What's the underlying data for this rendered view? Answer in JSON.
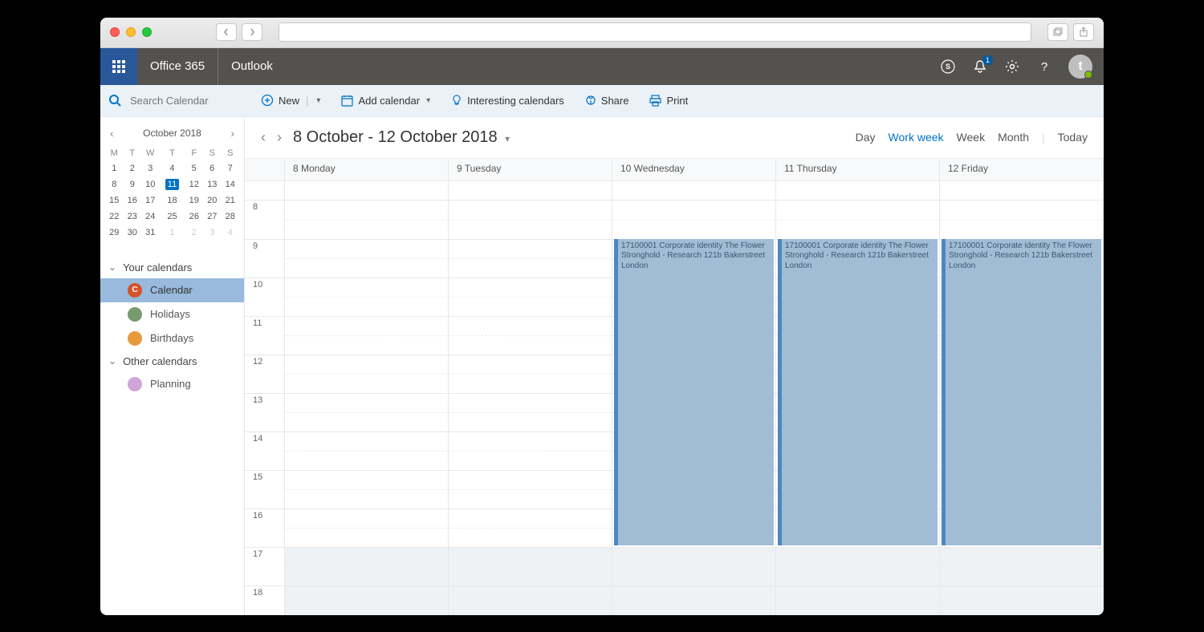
{
  "o365": {
    "suite": "Office 365",
    "app": "Outlook",
    "avatar_initial": "t",
    "notif_count": "1"
  },
  "search": {
    "placeholder": "Search Calendar"
  },
  "cmd": {
    "new": "New",
    "add_calendar": "Add calendar",
    "interesting": "Interesting calendars",
    "share": "Share",
    "print": "Print"
  },
  "range": {
    "title": "8 October - 12 October 2018"
  },
  "views": {
    "day": "Day",
    "work_week": "Work week",
    "week": "Week",
    "month": "Month",
    "today": "Today"
  },
  "minical": {
    "title": "October 2018",
    "dow": [
      "M",
      "T",
      "W",
      "T",
      "F",
      "S",
      "S"
    ],
    "rows": [
      [
        "1",
        "2",
        "3",
        "4",
        "5",
        "6",
        "7"
      ],
      [
        "8",
        "9",
        "10",
        "11",
        "12",
        "13",
        "14"
      ],
      [
        "15",
        "16",
        "17",
        "18",
        "19",
        "20",
        "21"
      ],
      [
        "22",
        "23",
        "24",
        "25",
        "26",
        "27",
        "28"
      ],
      [
        "29",
        "30",
        "31",
        "1",
        "2",
        "3",
        "4"
      ]
    ],
    "selected": "11",
    "dim_from_row": 4,
    "dim_from_col": 3
  },
  "groups": {
    "your": {
      "label": "Your calendars",
      "items": [
        {
          "label": "Calendar",
          "color": "#d35429",
          "initial": "C",
          "selected": true
        },
        {
          "label": "Holidays",
          "color": "#779a6f"
        },
        {
          "label": "Birthdays",
          "color": "#e79a3c"
        }
      ]
    },
    "other": {
      "label": "Other calendars",
      "items": [
        {
          "label": "Planning",
          "color": "#cfa6d8"
        }
      ]
    }
  },
  "days": [
    {
      "label": "8 Monday"
    },
    {
      "label": "9 Tuesday"
    },
    {
      "label": "10 Wednesday"
    },
    {
      "label": "11 Thursday"
    },
    {
      "label": "12 Friday"
    }
  ],
  "hours": [
    "8",
    "9",
    "10",
    "11",
    "12",
    "13",
    "14",
    "15",
    "16",
    "17",
    "18"
  ],
  "off_hours": [
    "17",
    "18"
  ],
  "events": {
    "text": "17100001 Corporate identity The Flower Stronghold - Research 121b Bakerstreet London",
    "start_hour": "9",
    "end_hour": "17",
    "on_days": [
      2,
      3,
      4
    ]
  }
}
